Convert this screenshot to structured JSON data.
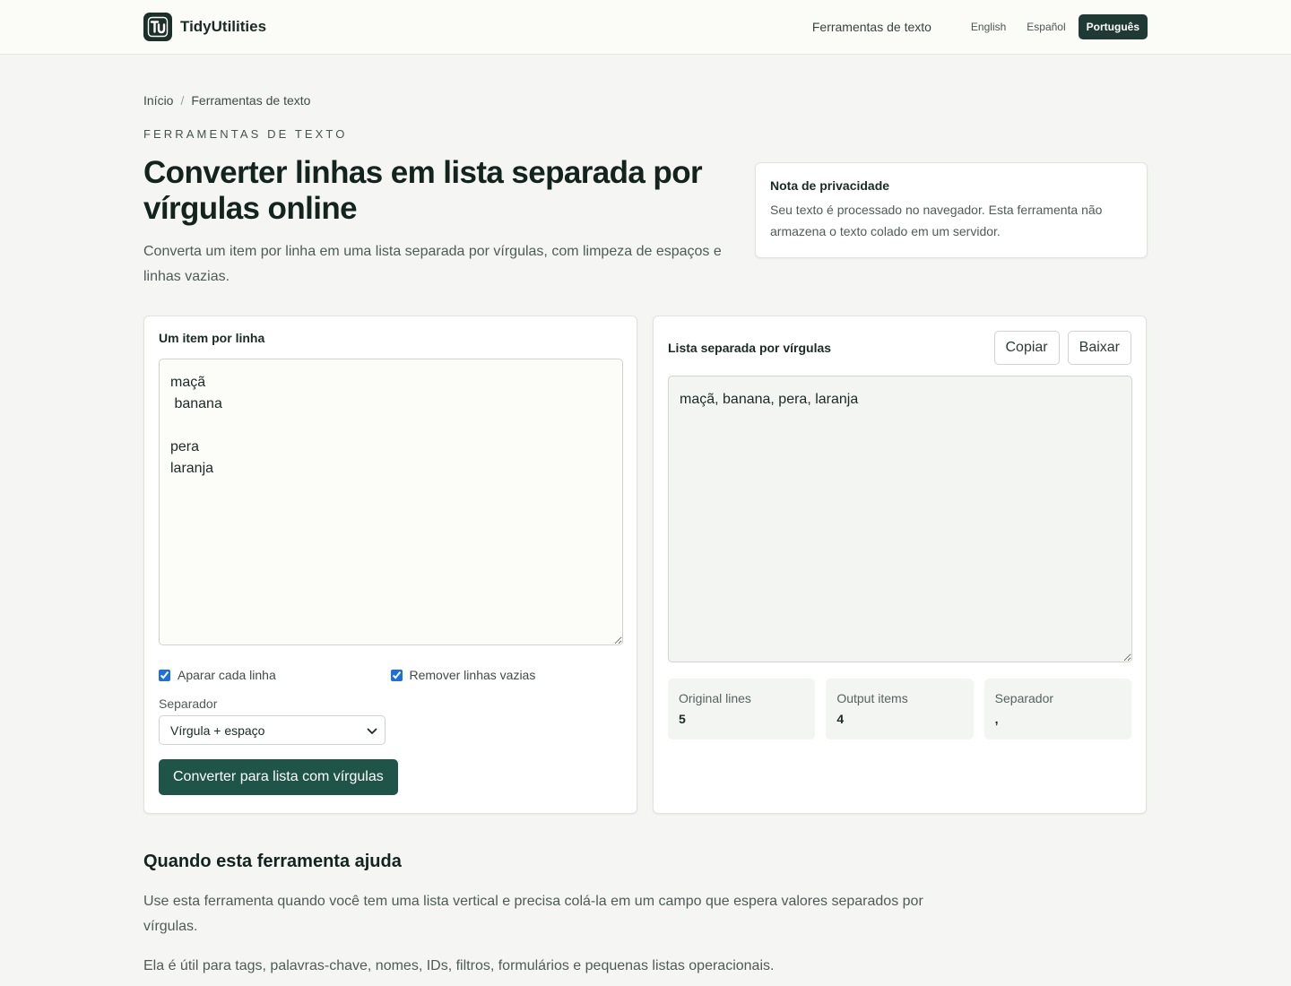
{
  "header": {
    "brand": "TidyUtilities",
    "nav_link": "Ferramentas de texto",
    "languages": [
      "English",
      "Español",
      "Português"
    ],
    "active_language": "Português"
  },
  "breadcrumb": {
    "home": "Início",
    "separator": "/",
    "current": "Ferramentas de texto"
  },
  "hero": {
    "eyebrow": "FERRAMENTAS DE TEXTO",
    "title": "Converter linhas em lista separada por vírgulas online",
    "lead": "Converta um item por linha em uma lista separada por vírgulas, com limpeza de espaços e linhas vazias."
  },
  "privacy": {
    "title": "Nota de privacidade",
    "text": "Seu texto é processado no navegador. Esta ferramenta não armazena o texto colado em um servidor."
  },
  "input_panel": {
    "label": "Um item por linha",
    "value": "maçã\n banana\n\npera\nlaranja",
    "options": {
      "trim_label": "Aparar cada linha",
      "trim_checked": true,
      "remove_empty_label": "Remover linhas vazias",
      "remove_empty_checked": true
    },
    "separator_label": "Separador",
    "separator_value": "Vírgula + espaço",
    "convert_button": "Converter para lista com vírgulas"
  },
  "output_panel": {
    "label": "Lista separada por vírgulas",
    "copy_button": "Copiar",
    "download_button": "Baixar",
    "value": "maçã, banana, pera, laranja",
    "stats": {
      "original_lines_label": "Original lines",
      "original_lines_value": "5",
      "output_items_label": "Output items",
      "output_items_value": "4",
      "separator_label": "Separador",
      "separator_value": ","
    }
  },
  "help": {
    "heading": "Quando esta ferramenta ajuda",
    "p1": "Use esta ferramenta quando você tem uma lista vertical e precisa colá-la em um campo que espera valores separados por vírgulas.",
    "p2": "Ela é útil para tags, palavras-chave, nomes, IDs, filtros, formulários e pequenas listas operacionais."
  },
  "colors": {
    "primary": "#1f5448",
    "active_lang_bg": "#1f3a34",
    "logo_bg": "#1d2f29",
    "checkbox": "#1b6fe0"
  },
  "icons": {
    "logo": "tu-logo-icon",
    "select_arrow": "chevron-down-icon"
  }
}
